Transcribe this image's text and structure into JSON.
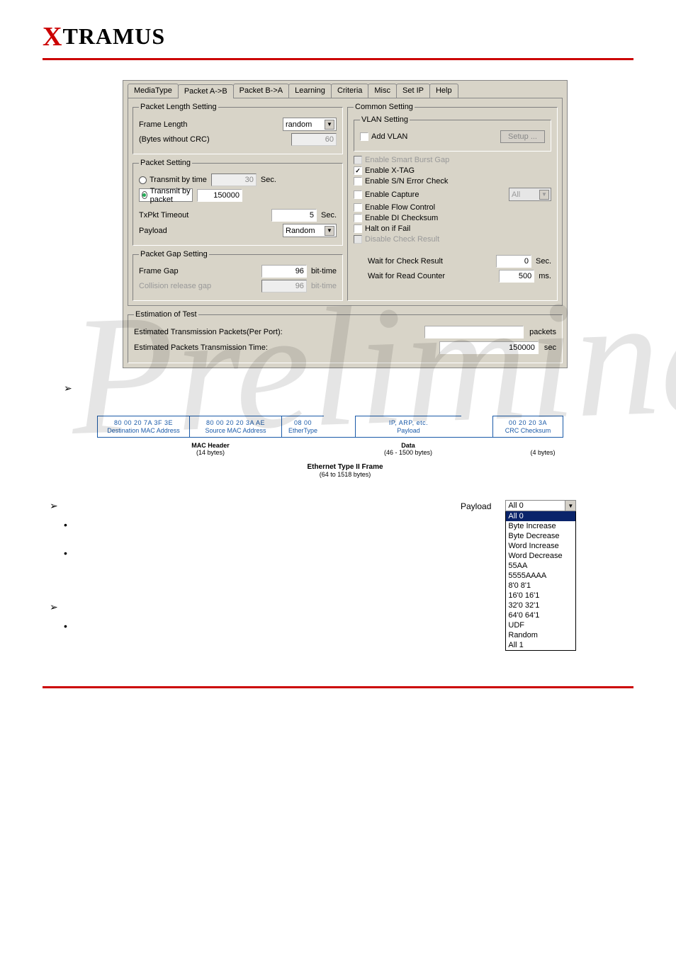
{
  "logo": {
    "brand_rest": "TRAMUS"
  },
  "dialog": {
    "tabs": [
      "MediaType",
      "Packet A->B",
      "Packet B->A",
      "Learning",
      "Criteria",
      "Misc",
      "Set IP",
      "Help"
    ],
    "active_tab_index": 1,
    "pkt_len": {
      "legend": "Packet Length Setting",
      "frame_length_label": "Frame Length",
      "frame_length_sel": "random",
      "bytes_label": "(Bytes without CRC)",
      "bytes_value": "60"
    },
    "pkt_set": {
      "legend": "Packet Setting",
      "by_time_label": "Transmit by time",
      "by_time_value": "30",
      "by_time_unit": "Sec.",
      "by_packet_label": "Transmit by packet",
      "by_packet_value": "150000",
      "txpkt_label": "TxPkt Timeout",
      "txpkt_value": "5",
      "txpkt_unit": "Sec.",
      "payload_label": "Payload",
      "payload_sel": "Random"
    },
    "pkt_gap": {
      "legend": "Packet Gap Setting",
      "frame_gap_label": "Frame Gap",
      "frame_gap_value": "96",
      "frame_gap_unit": "bit-time",
      "coll_label": "Collision release gap",
      "coll_value": "96",
      "coll_unit": "bit-time"
    },
    "common": {
      "legend": "Common Setting",
      "vlan_legend": "VLAN Setting",
      "add_vlan": "Add VLAN",
      "setup_btn": "Setup ...",
      "opts": {
        "smart": "Enable Smart Burst Gap",
        "xtag": "Enable X-TAG",
        "sn": "Enable S/N Error Check",
        "cap": "Enable Capture",
        "cap_sel": "All",
        "flow": "Enable Flow Control",
        "di": "Enable DI Checksum",
        "halt": "Halt on if Fail",
        "disresult": "Disable Check Result"
      },
      "wait_check_label": "Wait for Check Result",
      "wait_check_value": "0",
      "wait_check_unit": "Sec.",
      "wait_read_label": "Wait for Read Counter",
      "wait_read_value": "500",
      "wait_read_unit": "ms."
    },
    "estimation": {
      "legend": "Estimation of Test",
      "row1_label": "Estimated Transmission Packets(Per Port):",
      "row1_value": "",
      "row1_unit": "packets",
      "row2_label": "Estimated Packets Transmission Time:",
      "row2_value": "150000",
      "row2_unit": "sec"
    }
  },
  "frame": {
    "dest_hex": "80 00 20 7A 3F 3E",
    "dest_lab": "Destination MAC Address",
    "src_hex": "80 00 20 20 3A AE",
    "src_lab": "Source MAC Address",
    "et_hex": "08 00",
    "et_lab": "EtherType",
    "pl_hex": "IP, ARP, etc.",
    "pl_lab": "Payload",
    "crc_hex": "00 20 20 3A",
    "crc_lab": "CRC Checksum",
    "mac_header": "MAC Header",
    "mac_header_sz": "(14 bytes)",
    "data_lab": "Data",
    "data_sz": "(46 - 1500 bytes)",
    "crc_sz": "(4 bytes)",
    "title": "Ethernet Type II Frame",
    "title_sub": "(64 to 1518 bytes)"
  },
  "payload_dd": {
    "label": "Payload",
    "selected": "All 0",
    "options": [
      "All 0",
      "Byte Increase",
      "Byte Decrease",
      "Word Increase",
      "Word Decrease",
      "55AA",
      "5555AAAA",
      "8'0 8'1",
      "16'0 16'1",
      "32'0 32'1",
      "64'0 64'1",
      "UDF",
      "Random",
      "All 1"
    ]
  },
  "watermark": "Preliminary"
}
